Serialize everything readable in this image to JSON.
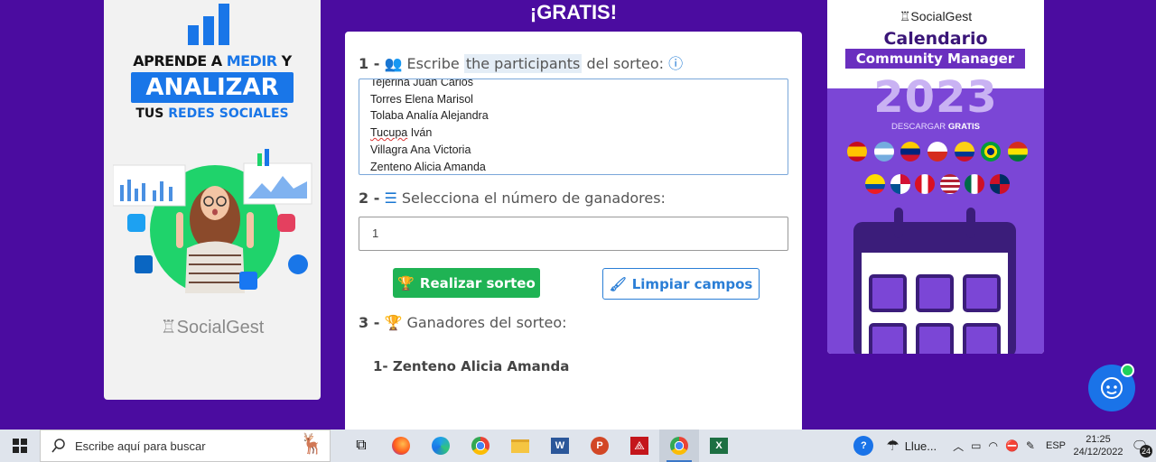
{
  "left_ad": {
    "line1_a": "APRENDE A ",
    "line1_b": "MEDIR",
    "line1_c": " Y",
    "line2": "ANALIZAR",
    "line3_a": "TUS ",
    "line3_b": "REDES SOCIALES",
    "brand": "SocialGest"
  },
  "header": {
    "title": "¡GRATIS!"
  },
  "step1": {
    "num": "1 -",
    "label_a": "Escribe ",
    "label_hl": "the participants",
    "label_b": " del sorteo:",
    "participants": [
      "Tejerina Juan Carlos",
      "Torres Elena Marisol",
      "Tolaba Analía Alejandra",
      "Tucupa",
      "Villagra Ana Victoria",
      "Zenteno Alicia Amanda"
    ],
    "tucupa_rest": " Iván"
  },
  "step2": {
    "num": "2 -",
    "label": "Selecciona el número de ganadores:",
    "value": "1"
  },
  "buttons": {
    "draw": "Realizar sorteo",
    "clear": "Limpiar campos"
  },
  "step3": {
    "num": "3 -",
    "label": "Ganadores del sorteo:",
    "winner": "1- Zenteno Alicia Amanda"
  },
  "right_ad": {
    "brand": "SocialGest",
    "title": "Calendario",
    "subtitle": "Community Manager",
    "year": "2023",
    "download_a": "DESCARGAR ",
    "download_b": "GRATIS"
  },
  "taskbar": {
    "search_placeholder": "Escribe aquí para buscar",
    "weather": "Llue...",
    "language": "ESP",
    "time": "21:25",
    "date": "24/12/2022",
    "notifications": "24"
  },
  "colors": {
    "background": "#4b0ca0",
    "accent_blue": "#1976d2",
    "button_green": "#1fb354"
  }
}
